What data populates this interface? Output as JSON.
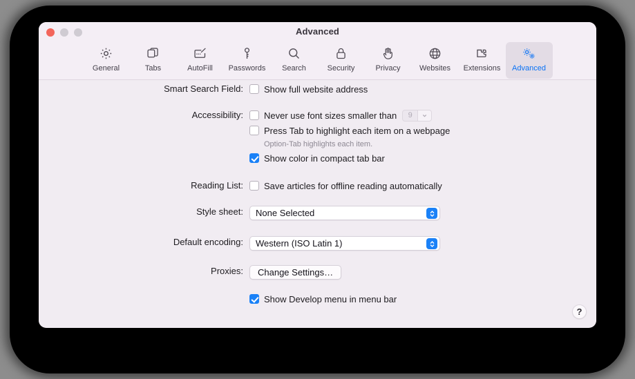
{
  "window": {
    "title": "Advanced",
    "traffic_lights": [
      "close",
      "minimize",
      "maximize"
    ]
  },
  "toolbar": {
    "items": [
      {
        "label": "General",
        "icon": "gear-icon",
        "selected": false
      },
      {
        "label": "Tabs",
        "icon": "tabs-icon",
        "selected": false
      },
      {
        "label": "AutoFill",
        "icon": "autofill-icon",
        "selected": false
      },
      {
        "label": "Passwords",
        "icon": "key-icon",
        "selected": false
      },
      {
        "label": "Search",
        "icon": "search-icon",
        "selected": false
      },
      {
        "label": "Security",
        "icon": "lock-icon",
        "selected": false
      },
      {
        "label": "Privacy",
        "icon": "hand-icon",
        "selected": false
      },
      {
        "label": "Websites",
        "icon": "globe-icon",
        "selected": false
      },
      {
        "label": "Extensions",
        "icon": "puzzle-icon",
        "selected": false
      },
      {
        "label": "Advanced",
        "icon": "double-gear-icon",
        "selected": true
      }
    ]
  },
  "settings": {
    "smart_search_field": {
      "label": "Smart Search Field:",
      "show_full_address": {
        "text": "Show full website address",
        "checked": false
      }
    },
    "accessibility": {
      "label": "Accessibility:",
      "min_font_size": {
        "text": "Never use font sizes smaller than",
        "checked": false,
        "value": "9",
        "disabled": true
      },
      "tab_highlight": {
        "text": "Press Tab to highlight each item on a webpage",
        "checked": false
      },
      "hint": "Option-Tab highlights each item.",
      "compact_tab_color": {
        "text": "Show color in compact tab bar",
        "checked": true
      }
    },
    "reading_list": {
      "label": "Reading List:",
      "save_offline": {
        "text": "Save articles for offline reading automatically",
        "checked": false
      }
    },
    "style_sheet": {
      "label": "Style sheet:",
      "value": "None Selected"
    },
    "default_encoding": {
      "label": "Default encoding:",
      "value": "Western (ISO Latin 1)"
    },
    "proxies": {
      "label": "Proxies:",
      "button": "Change Settings…"
    },
    "develop_menu": {
      "text": "Show Develop menu in menu bar",
      "checked": true
    }
  },
  "help": {
    "glyph": "?"
  },
  "colors": {
    "accent": "#1a81f7",
    "window_bg": "#f1ecf2",
    "toolbar_bg": "#f4eef5",
    "close": "#f3655b"
  }
}
